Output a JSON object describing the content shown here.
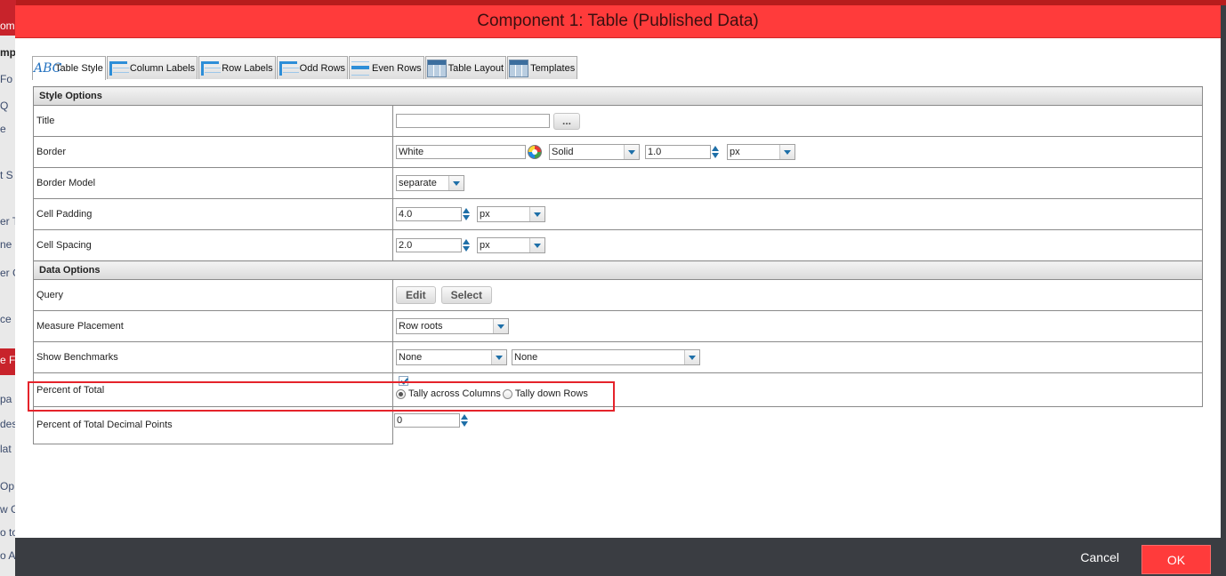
{
  "dialog": {
    "title": "Component 1: Table (Published Data)"
  },
  "background_fragments": [
    "om",
    "mp",
    "Fo",
    "Q",
    "e",
    "t S",
    "er T",
    "ne",
    "er G",
    "ce",
    "e F",
    "pa",
    "des",
    "lat",
    "Op",
    "w G",
    "o to",
    "o A"
  ],
  "tabs": [
    {
      "label": "Table Style",
      "icon": "abc-icon",
      "active": true
    },
    {
      "label": "Column Labels",
      "icon": "column-labels-icon",
      "active": false
    },
    {
      "label": "Row Labels",
      "icon": "row-labels-icon",
      "active": false
    },
    {
      "label": "Odd Rows",
      "icon": "odd-rows-icon",
      "active": false
    },
    {
      "label": "Even Rows",
      "icon": "even-rows-icon",
      "active": false
    },
    {
      "label": "Table Layout",
      "icon": "table-layout-icon",
      "active": false
    },
    {
      "label": "Templates",
      "icon": "templates-icon",
      "active": false
    }
  ],
  "style_options": {
    "header": "Style Options",
    "title": {
      "label": "Title",
      "value": "",
      "button": "..."
    },
    "border": {
      "label": "Border",
      "color": "White",
      "style": "Solid",
      "width": "1.0",
      "unit": "px"
    },
    "border_model": {
      "label": "Border Model",
      "value": "separate"
    },
    "cell_padding": {
      "label": "Cell Padding",
      "value": "4.0",
      "unit": "px"
    },
    "cell_spacing": {
      "label": "Cell Spacing",
      "value": "2.0",
      "unit": "px"
    }
  },
  "data_options": {
    "header": "Data Options",
    "query": {
      "label": "Query",
      "edit": "Edit",
      "select": "Select"
    },
    "measure_placement": {
      "label": "Measure Placement",
      "value": "Row roots"
    },
    "show_benchmarks": {
      "label": "Show Benchmarks",
      "value1": "None",
      "value2": "None"
    },
    "percent_of_total": {
      "label": "Percent of Total",
      "checked": true,
      "option1": "Tally across Columns",
      "option2": "Tally down Rows",
      "selected": "Tally across Columns"
    },
    "decimal_points": {
      "label": "Percent of Total Decimal Points",
      "value": "0"
    }
  },
  "footer": {
    "cancel": "Cancel",
    "ok": "OK"
  },
  "colors": {
    "accent": "#ff3b3b",
    "footer": "#3a3d42",
    "highlight": "#e5232b",
    "link": "#1e6fa8"
  }
}
